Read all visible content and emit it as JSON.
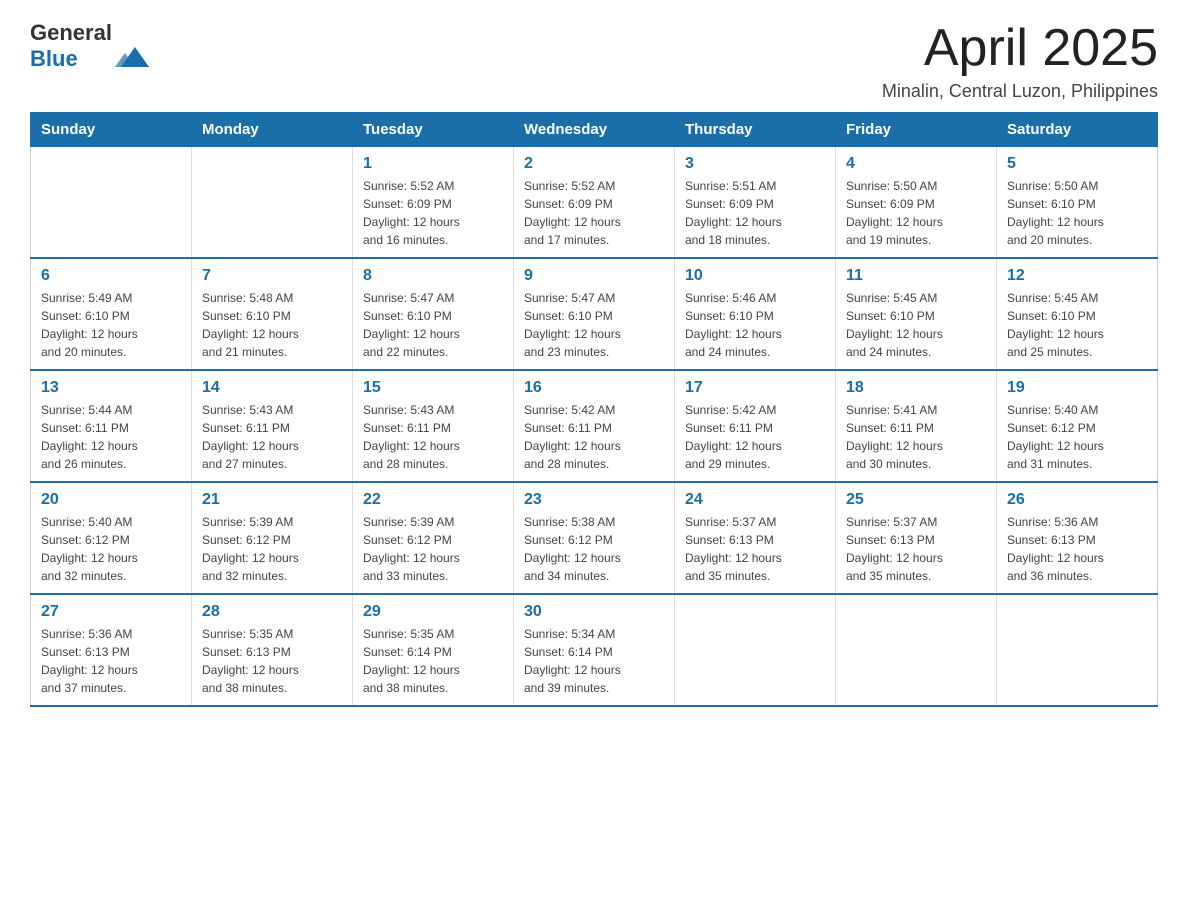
{
  "header": {
    "logo_general": "General",
    "logo_blue": "Blue",
    "month": "April 2025",
    "location": "Minalin, Central Luzon, Philippines"
  },
  "weekdays": [
    "Sunday",
    "Monday",
    "Tuesday",
    "Wednesday",
    "Thursday",
    "Friday",
    "Saturday"
  ],
  "weeks": [
    [
      {
        "day": "",
        "info": ""
      },
      {
        "day": "",
        "info": ""
      },
      {
        "day": "1",
        "info": "Sunrise: 5:52 AM\nSunset: 6:09 PM\nDaylight: 12 hours\nand 16 minutes."
      },
      {
        "day": "2",
        "info": "Sunrise: 5:52 AM\nSunset: 6:09 PM\nDaylight: 12 hours\nand 17 minutes."
      },
      {
        "day": "3",
        "info": "Sunrise: 5:51 AM\nSunset: 6:09 PM\nDaylight: 12 hours\nand 18 minutes."
      },
      {
        "day": "4",
        "info": "Sunrise: 5:50 AM\nSunset: 6:09 PM\nDaylight: 12 hours\nand 19 minutes."
      },
      {
        "day": "5",
        "info": "Sunrise: 5:50 AM\nSunset: 6:10 PM\nDaylight: 12 hours\nand 20 minutes."
      }
    ],
    [
      {
        "day": "6",
        "info": "Sunrise: 5:49 AM\nSunset: 6:10 PM\nDaylight: 12 hours\nand 20 minutes."
      },
      {
        "day": "7",
        "info": "Sunrise: 5:48 AM\nSunset: 6:10 PM\nDaylight: 12 hours\nand 21 minutes."
      },
      {
        "day": "8",
        "info": "Sunrise: 5:47 AM\nSunset: 6:10 PM\nDaylight: 12 hours\nand 22 minutes."
      },
      {
        "day": "9",
        "info": "Sunrise: 5:47 AM\nSunset: 6:10 PM\nDaylight: 12 hours\nand 23 minutes."
      },
      {
        "day": "10",
        "info": "Sunrise: 5:46 AM\nSunset: 6:10 PM\nDaylight: 12 hours\nand 24 minutes."
      },
      {
        "day": "11",
        "info": "Sunrise: 5:45 AM\nSunset: 6:10 PM\nDaylight: 12 hours\nand 24 minutes."
      },
      {
        "day": "12",
        "info": "Sunrise: 5:45 AM\nSunset: 6:10 PM\nDaylight: 12 hours\nand 25 minutes."
      }
    ],
    [
      {
        "day": "13",
        "info": "Sunrise: 5:44 AM\nSunset: 6:11 PM\nDaylight: 12 hours\nand 26 minutes."
      },
      {
        "day": "14",
        "info": "Sunrise: 5:43 AM\nSunset: 6:11 PM\nDaylight: 12 hours\nand 27 minutes."
      },
      {
        "day": "15",
        "info": "Sunrise: 5:43 AM\nSunset: 6:11 PM\nDaylight: 12 hours\nand 28 minutes."
      },
      {
        "day": "16",
        "info": "Sunrise: 5:42 AM\nSunset: 6:11 PM\nDaylight: 12 hours\nand 28 minutes."
      },
      {
        "day": "17",
        "info": "Sunrise: 5:42 AM\nSunset: 6:11 PM\nDaylight: 12 hours\nand 29 minutes."
      },
      {
        "day": "18",
        "info": "Sunrise: 5:41 AM\nSunset: 6:11 PM\nDaylight: 12 hours\nand 30 minutes."
      },
      {
        "day": "19",
        "info": "Sunrise: 5:40 AM\nSunset: 6:12 PM\nDaylight: 12 hours\nand 31 minutes."
      }
    ],
    [
      {
        "day": "20",
        "info": "Sunrise: 5:40 AM\nSunset: 6:12 PM\nDaylight: 12 hours\nand 32 minutes."
      },
      {
        "day": "21",
        "info": "Sunrise: 5:39 AM\nSunset: 6:12 PM\nDaylight: 12 hours\nand 32 minutes."
      },
      {
        "day": "22",
        "info": "Sunrise: 5:39 AM\nSunset: 6:12 PM\nDaylight: 12 hours\nand 33 minutes."
      },
      {
        "day": "23",
        "info": "Sunrise: 5:38 AM\nSunset: 6:12 PM\nDaylight: 12 hours\nand 34 minutes."
      },
      {
        "day": "24",
        "info": "Sunrise: 5:37 AM\nSunset: 6:13 PM\nDaylight: 12 hours\nand 35 minutes."
      },
      {
        "day": "25",
        "info": "Sunrise: 5:37 AM\nSunset: 6:13 PM\nDaylight: 12 hours\nand 35 minutes."
      },
      {
        "day": "26",
        "info": "Sunrise: 5:36 AM\nSunset: 6:13 PM\nDaylight: 12 hours\nand 36 minutes."
      }
    ],
    [
      {
        "day": "27",
        "info": "Sunrise: 5:36 AM\nSunset: 6:13 PM\nDaylight: 12 hours\nand 37 minutes."
      },
      {
        "day": "28",
        "info": "Sunrise: 5:35 AM\nSunset: 6:13 PM\nDaylight: 12 hours\nand 38 minutes."
      },
      {
        "day": "29",
        "info": "Sunrise: 5:35 AM\nSunset: 6:14 PM\nDaylight: 12 hours\nand 38 minutes."
      },
      {
        "day": "30",
        "info": "Sunrise: 5:34 AM\nSunset: 6:14 PM\nDaylight: 12 hours\nand 39 minutes."
      },
      {
        "day": "",
        "info": ""
      },
      {
        "day": "",
        "info": ""
      },
      {
        "day": "",
        "info": ""
      }
    ]
  ]
}
